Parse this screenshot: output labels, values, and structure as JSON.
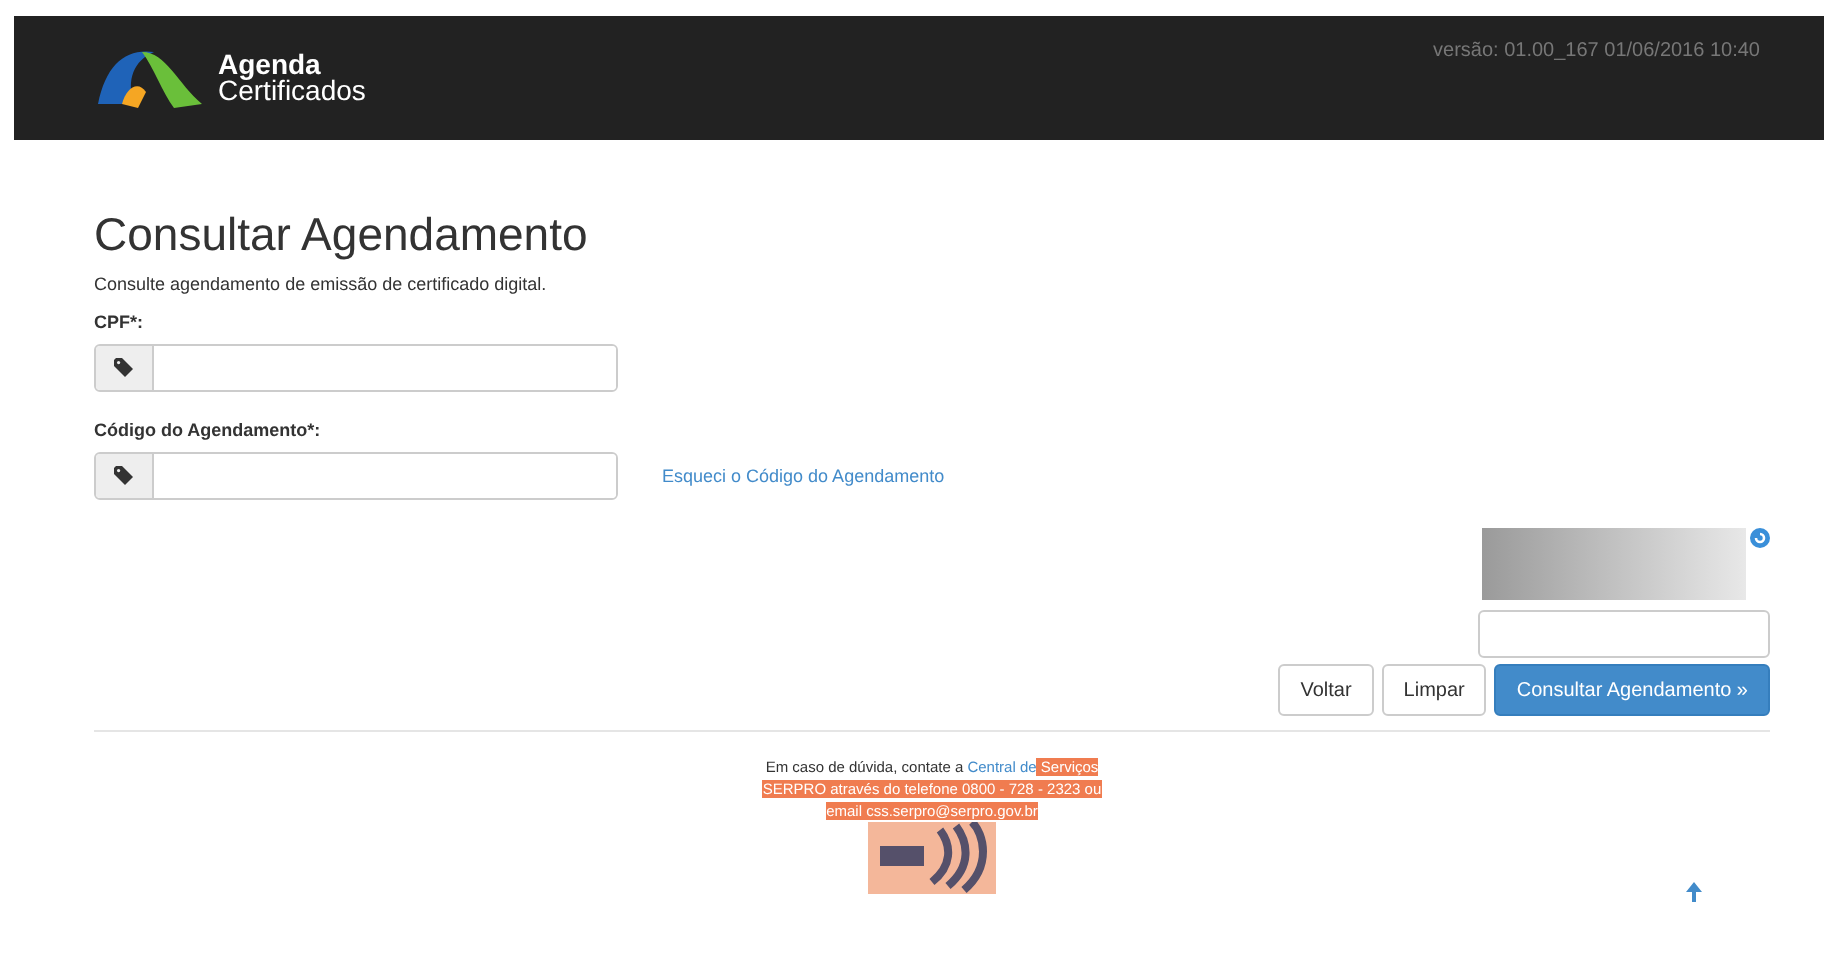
{
  "header": {
    "logo_line_1": "Agenda",
    "logo_line_2": "Certificados",
    "version": "versão: 01.00_167 01/06/2016 10:40"
  },
  "page": {
    "title": "Consultar Agendamento",
    "subtitle": "Consulte agendamento de emissão de certificado digital."
  },
  "fields": [
    {
      "label": "CPF*:"
    },
    {
      "label": "Código do Agendamento*:",
      "link": "Esqueci o Código do Agendamento"
    }
  ],
  "buttons": [
    {
      "label": "Voltar",
      "kind": "default"
    },
    {
      "label": "Limpar",
      "kind": "default"
    },
    {
      "label": "Consultar Agendamento »",
      "kind": "primary"
    }
  ],
  "footer": {
    "text": "Em caso de dúvida, contate a ",
    "link": "Central de",
    "highlighted": " Serviços SERPRO através do telefone 0800 - 728 - 2323 ou email css.serpro@serpro.gov.br"
  }
}
